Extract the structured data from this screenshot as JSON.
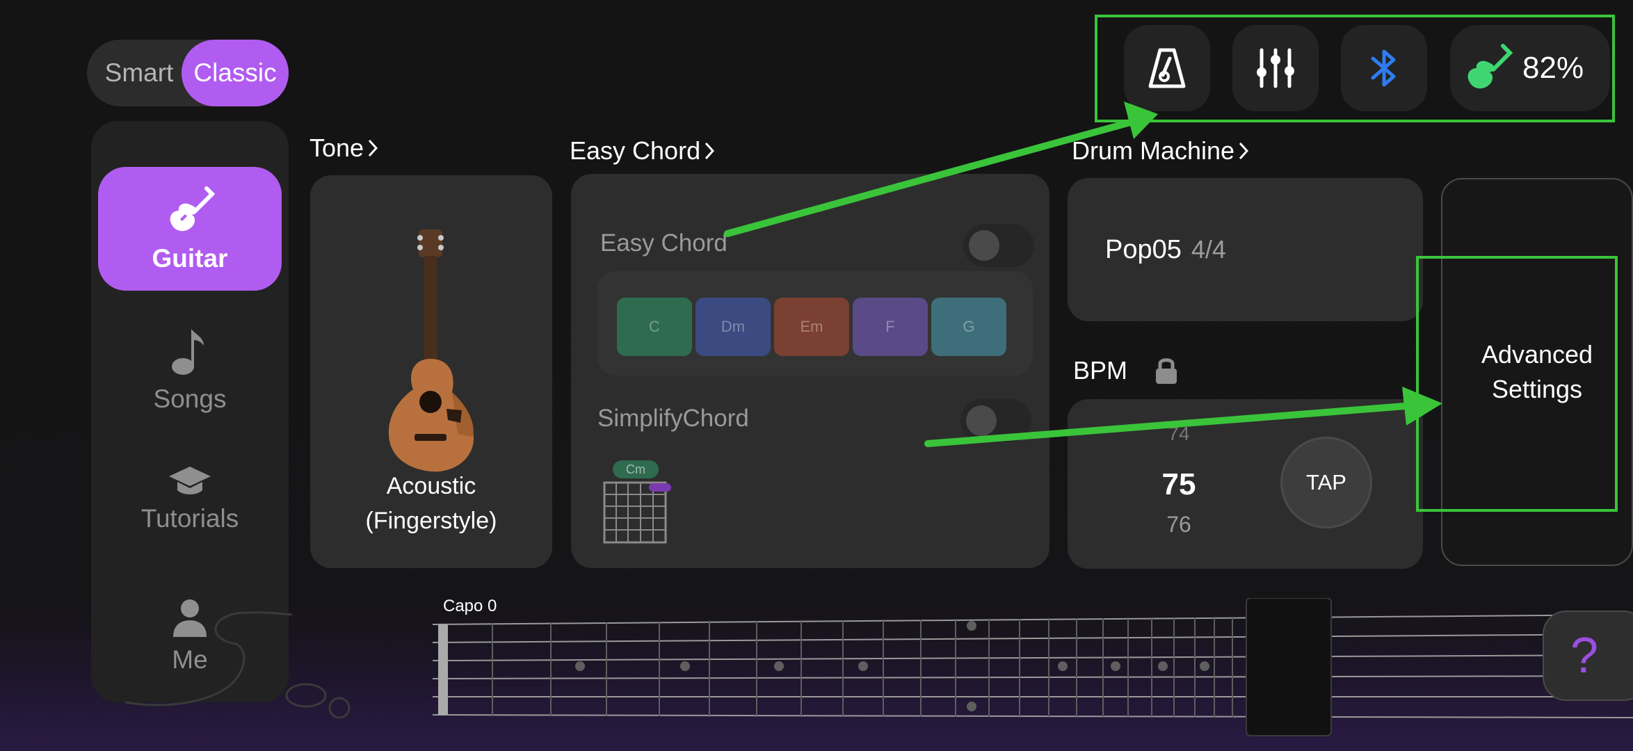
{
  "mode_toggle": {
    "smart_label": "Smart",
    "classic_label": "Classic",
    "selected": "Classic"
  },
  "sidebar": {
    "items": [
      {
        "label": "Guitar",
        "icon": "guitar-icon",
        "active": true
      },
      {
        "label": "Songs",
        "icon": "music-note-icon",
        "active": false
      },
      {
        "label": "Tutorials",
        "icon": "graduation-cap-icon",
        "active": false
      },
      {
        "label": "Me",
        "icon": "user-icon",
        "active": false
      }
    ]
  },
  "tone": {
    "title": "Tone",
    "name_line1": "Acoustic",
    "name_line2": "(Fingerstyle)"
  },
  "easy_chord": {
    "title": "Easy Chord",
    "toggle_label": "Easy Chord",
    "chords": [
      {
        "name": "C",
        "color": "#2f6b4f"
      },
      {
        "name": "Dm",
        "color": "#3b4a80"
      },
      {
        "name": "Em",
        "color": "#7a4032"
      },
      {
        "name": "F",
        "color": "#5a4a86"
      },
      {
        "name": "G",
        "color": "#3e6e7a"
      }
    ],
    "simplify_label": "SimplifyChord",
    "diagram_chord": "Cm"
  },
  "drum_machine": {
    "title": "Drum Machine",
    "pattern": "Pop05",
    "time_signature": "4/4"
  },
  "bpm": {
    "label": "BPM",
    "prev": "74",
    "current": "75",
    "next": "76",
    "tap_label": "TAP"
  },
  "top_bar": {
    "icons": [
      "metronome-icon",
      "mixer-icon",
      "bluetooth-icon"
    ],
    "battery_percent": "82%",
    "battery_icon": "guitar-battery-icon"
  },
  "advanced": {
    "line1": "Advanced",
    "line2": "Settings"
  },
  "fretboard": {
    "capo_label": "Capo 0"
  },
  "help": {
    "label": "?"
  },
  "colors": {
    "accent": "#b15cf0",
    "annotation": "#3ac43a",
    "bluetooth": "#2f7cf0",
    "battery": "#3fd672"
  }
}
